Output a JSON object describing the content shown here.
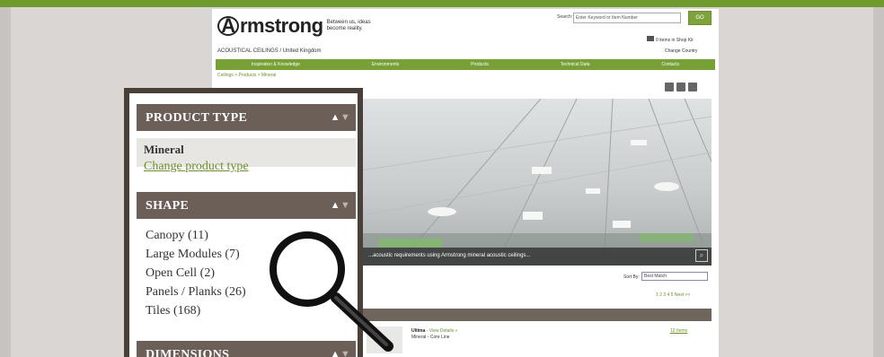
{
  "site": {
    "logo_text": "rmstrong",
    "logo_letter": "A",
    "tagline": "Between us, ideas become reality.",
    "region": "ACOUSTICAL CEILINGS / United Kingdom",
    "search_label": "Search:",
    "search_placeholder": "Enter Keyword or Item Number",
    "search_button": "GO",
    "cart_label": "0 items in Shop Kit",
    "country_label": "Change Country",
    "nav": [
      "Inspiration & Knowledge",
      "Environments",
      "Products",
      "Technical Data",
      "Contacts"
    ],
    "breadcrumb": "Ceilings > Products > Mineral",
    "hero_caption": "...acoustic requirements using Armstrong mineral acoustic ceilings...",
    "sort_label": "Sort By:",
    "sort_value": "Best Match",
    "pager": "1 2 3 4 5 Next >>",
    "result": {
      "title": "Ultima",
      "link": "- View Details »",
      "subtitle": "Mineral - Core Line",
      "right_link": "12 Items"
    }
  },
  "panel": {
    "product_type": {
      "header": "PRODUCT TYPE",
      "selected": "Mineral",
      "change_link": "Change product type"
    },
    "shape": {
      "header": "SHAPE",
      "items": [
        "Canopy (11)",
        "Large Modules (7)",
        "Open Cell (2)",
        "Panels / Planks (26)",
        "Tiles (168)"
      ]
    },
    "dimensions": {
      "header": "DIMENSIONS"
    }
  },
  "colors": {
    "brand_green": "#77a036",
    "panel_header": "#6b5f57",
    "panel_border": "#4a403a",
    "link_green": "#6b8f2c"
  },
  "icons": [
    "magnifier-icon",
    "collapse-arrow-icon",
    "expand-arrow-icon",
    "cart-icon",
    "share-icon",
    "zoom-icon"
  ]
}
